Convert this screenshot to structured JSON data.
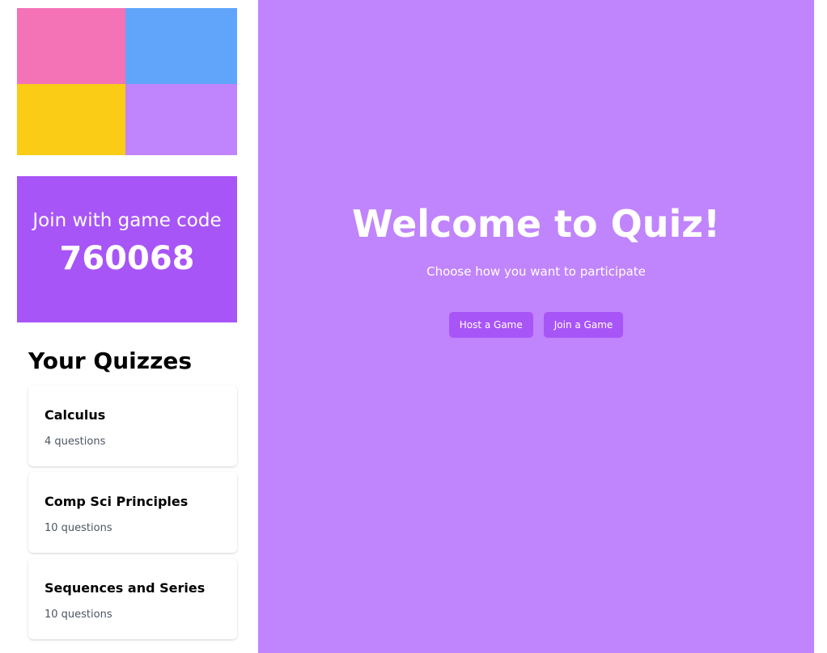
{
  "colors": {
    "logo": [
      "#f472b6",
      "#60a5fa",
      "#facc15",
      "#c084fc"
    ],
    "accent": "#a855f7",
    "panel": "#c084fc"
  },
  "game_code": {
    "label": "Join with game code",
    "code": "760068"
  },
  "quizzes": {
    "heading": "Your Quizzes",
    "items": [
      {
        "title": "Calculus",
        "count": "4 questions"
      },
      {
        "title": "Comp Sci Principles",
        "count": "10 questions"
      },
      {
        "title": "Sequences and Series",
        "count": "10 questions"
      }
    ]
  },
  "main": {
    "title": "Welcome to Quiz!",
    "subtitle": "Choose how you want to participate",
    "host_label": "Host a Game",
    "join_label": "Join a Game"
  }
}
